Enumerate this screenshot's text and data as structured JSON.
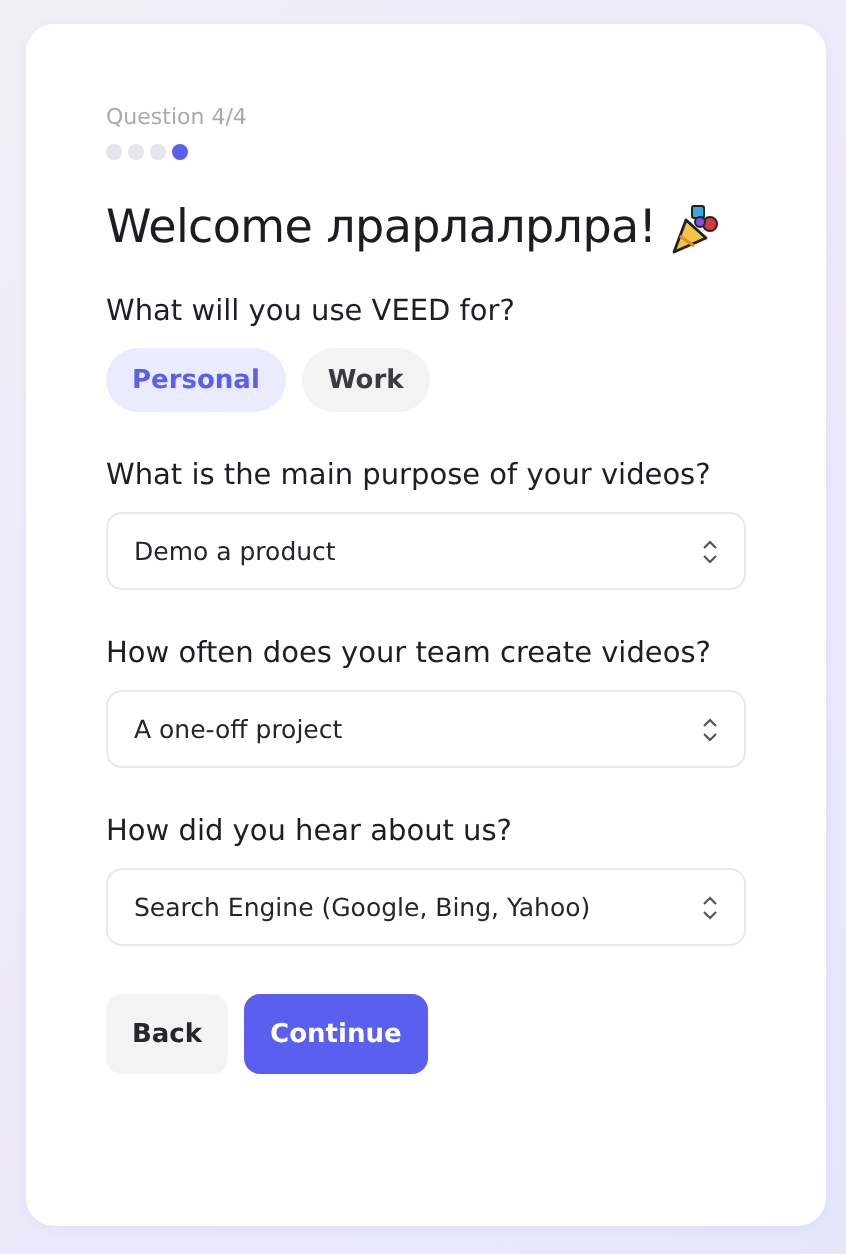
{
  "progress": {
    "label": "Question 4/4",
    "steps": [
      {
        "active": false
      },
      {
        "active": false
      },
      {
        "active": false
      },
      {
        "active": true
      }
    ]
  },
  "title": "Welcome лрарлалрлра!",
  "questions": [
    {
      "kind": "choice",
      "label": "What will you use VEED for?",
      "options": [
        {
          "label": "Personal",
          "selected": true
        },
        {
          "label": "Work",
          "selected": false
        }
      ]
    },
    {
      "kind": "select",
      "label": "What is the main purpose of your videos?",
      "value": "Demo a product"
    },
    {
      "kind": "select",
      "label": "How often does your team create videos?",
      "value": "A one-off project"
    },
    {
      "kind": "select",
      "label": "How did you hear about us?",
      "value": "Search Engine (Google, Bing, Yahoo)"
    }
  ],
  "buttons": [
    {
      "label": "Back",
      "kind": "secondary"
    },
    {
      "label": "Continue",
      "kind": "primary"
    }
  ]
}
